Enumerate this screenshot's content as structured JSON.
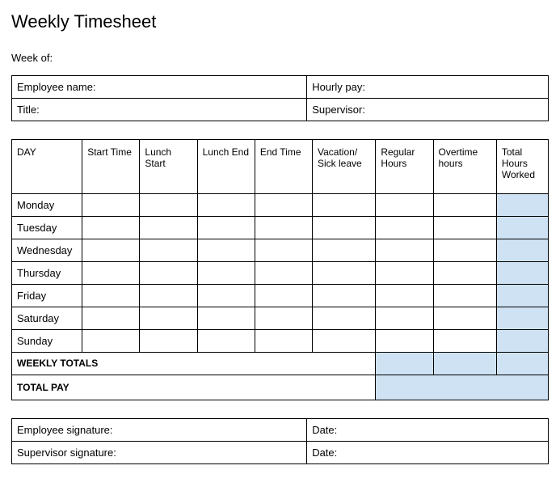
{
  "title": "Weekly Timesheet",
  "week_of_label": "Week of:",
  "info": {
    "employee_name_label": "Employee name:",
    "hourly_pay_label": "Hourly pay:",
    "title_label": "Title:",
    "supervisor_label": "Supervisor:"
  },
  "headers": {
    "day": "DAY",
    "start_time": "Start Time",
    "lunch_start": "Lunch Start",
    "lunch_end": "Lunch End",
    "end_time": "End Time",
    "vacation_sick": "Vacation/ Sick leave",
    "regular_hours": "Regular Hours",
    "overtime_hours": "Overtime hours",
    "total_hours": "Total Hours Worked"
  },
  "days": {
    "mon": "Monday",
    "tue": "Tuesday",
    "wed": "Wednesday",
    "thu": "Thursday",
    "fri": "Friday",
    "sat": "Saturday",
    "sun": "Sunday"
  },
  "weekly_totals_label": "WEEKLY TOTALS",
  "total_pay_label": "TOTAL PAY",
  "signatures": {
    "employee_sig_label": "Employee signature:",
    "supervisor_sig_label": "Supervisor signature:",
    "date_label": "Date:"
  }
}
